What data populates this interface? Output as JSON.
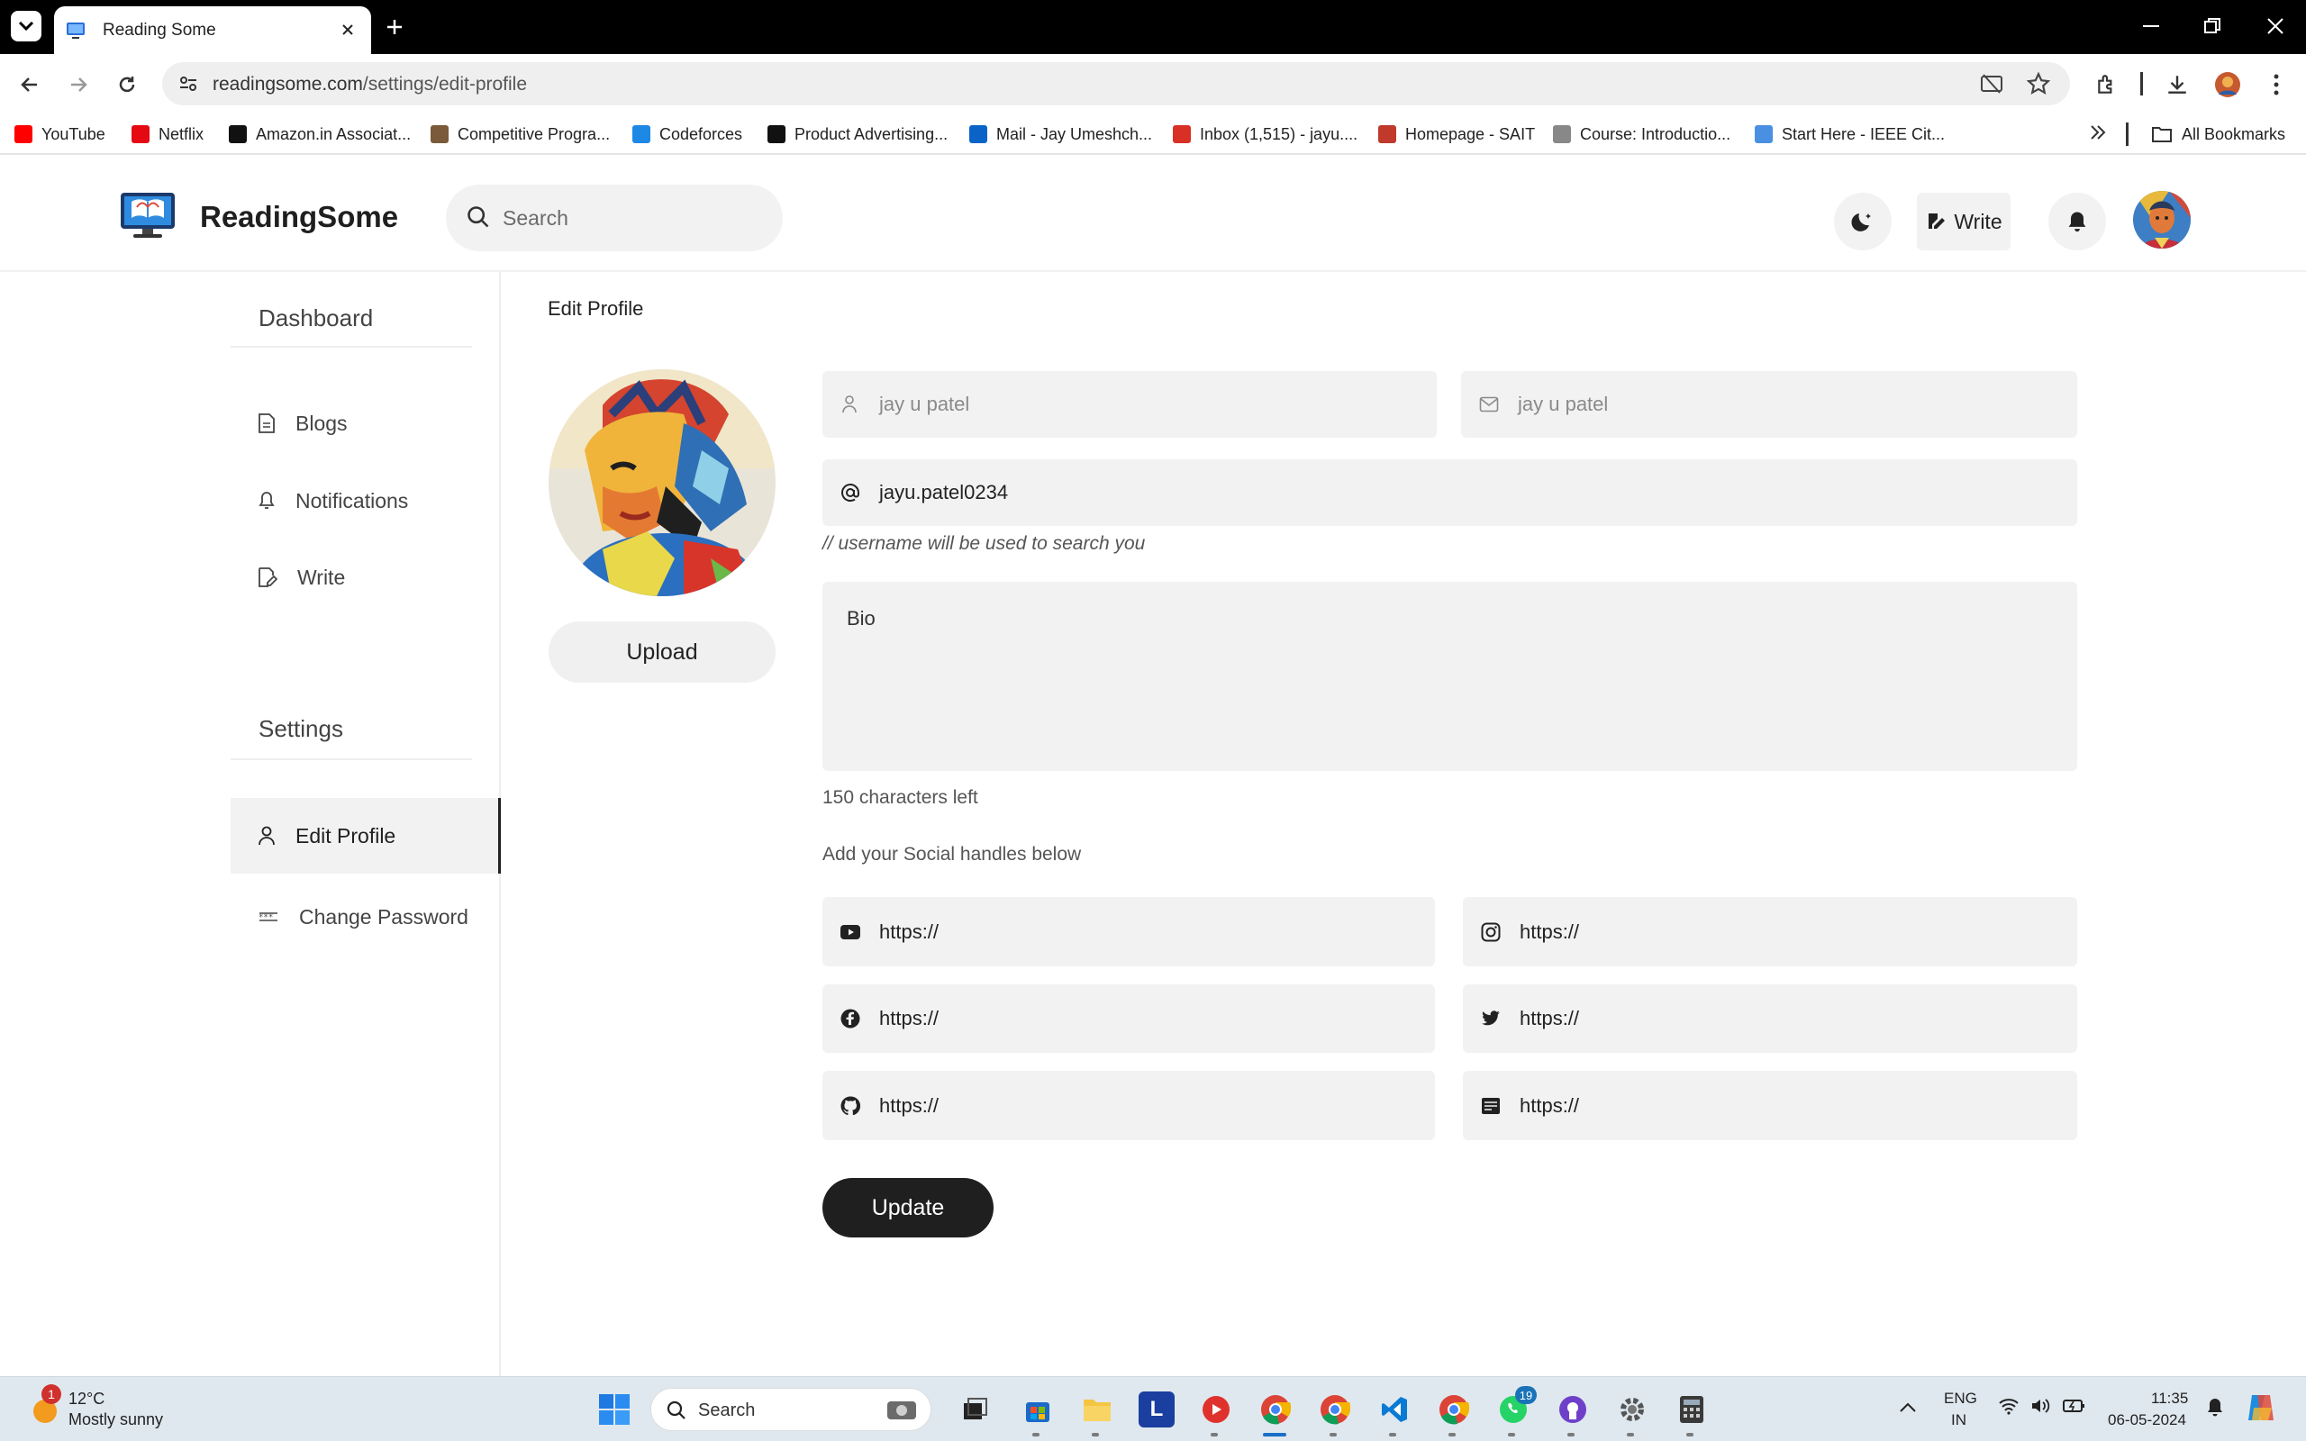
{
  "browser": {
    "tab_title": "Reading Some",
    "url_domain": "readingsome.com",
    "url_path": "/settings/edit-profile",
    "bookmarks": [
      {
        "label": "YouTube",
        "icon": "youtube-icon",
        "color": "#ff0000"
      },
      {
        "label": "Netflix",
        "icon": "netflix-icon",
        "color": "#e50914"
      },
      {
        "label": "Amazon.in Associat...",
        "icon": "amazon-icon",
        "color": "#111111"
      },
      {
        "label": "Competitive Progra...",
        "icon": "cc-icon",
        "color": "#7a5a3a"
      },
      {
        "label": "Codeforces",
        "icon": "codeforces-icon",
        "color": "#1e88e5"
      },
      {
        "label": "Product Advertising...",
        "icon": "amazon-icon",
        "color": "#111111"
      },
      {
        "label": "Mail - Jay Umeshch...",
        "icon": "outlook-icon",
        "color": "#0a64c8"
      },
      {
        "label": "Inbox (1,515) - jayu....",
        "icon": "gmail-icon",
        "color": "#d93025"
      },
      {
        "label": "Homepage - SAIT",
        "icon": "sait-icon",
        "color": "#c0392b"
      },
      {
        "label": "Course: Introductio...",
        "icon": "moodle-icon",
        "color": "#888888"
      },
      {
        "label": "Start Here - IEEE Cit...",
        "icon": "cloud-icon",
        "color": "#4a90e2"
      }
    ],
    "all_bookmarks": "All Bookmarks"
  },
  "app": {
    "brand": "ReadingSome",
    "search_placeholder": "Search",
    "write_label": "Write"
  },
  "sidebar": {
    "dashboard_heading": "Dashboard",
    "dashboard_items": [
      {
        "label": "Blogs",
        "icon": "document-icon"
      },
      {
        "label": "Notifications",
        "icon": "bell-icon"
      },
      {
        "label": "Write",
        "icon": "edit-icon"
      }
    ],
    "settings_heading": "Settings",
    "settings_items": [
      {
        "label": "Edit Profile",
        "icon": "user-icon",
        "active": true
      },
      {
        "label": "Change Password",
        "icon": "password-icon",
        "active": false
      }
    ]
  },
  "main": {
    "page_title": "Edit Profile",
    "upload_label": "Upload",
    "fullname_value": "jay u patel",
    "email_value": "jay u patel",
    "username_value": "jayu.patel0234",
    "username_hint": "// username will be used to search you",
    "bio_placeholder": "Bio",
    "chars_left": "150 characters left",
    "social_heading": "Add your Social handles below",
    "socials": {
      "youtube": "https://",
      "instagram": "https://",
      "facebook": "https://",
      "twitter": "https://",
      "github": "https://",
      "website": "https://"
    },
    "update_label": "Update"
  },
  "taskbar": {
    "weather_temp": "12°C",
    "weather_desc": "Mostly sunny",
    "weather_badge": "1",
    "search_label": "Search",
    "whatsapp_badge": "19",
    "lang_top": "ENG",
    "lang_bottom": "IN",
    "time": "11:35",
    "date": "06-05-2024"
  }
}
